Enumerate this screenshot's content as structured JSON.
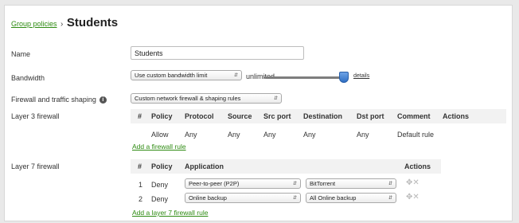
{
  "breadcrumb": {
    "parent": "Group policies",
    "separator": "›",
    "title": "Students"
  },
  "name": {
    "label": "Name",
    "value": "Students"
  },
  "bandwidth": {
    "label": "Bandwidth",
    "select_value": "Use custom bandwidth limit",
    "limit_text": "unlimited",
    "details_link": "details",
    "slider_level": "unlimited"
  },
  "firewall_shaping": {
    "label": "Firewall and traffic shaping",
    "select_value": "Custom network firewall & shaping rules"
  },
  "layer3": {
    "label": "Layer 3 firewall",
    "headers": [
      "#",
      "Policy",
      "Protocol",
      "Source",
      "Src port",
      "Destination",
      "Dst port",
      "Comment",
      "Actions"
    ],
    "rows": [
      {
        "num": "",
        "policy": "Allow",
        "protocol": "Any",
        "source": "Any",
        "src_port": "Any",
        "destination": "Any",
        "dst_port": "Any",
        "comment": "Default rule"
      }
    ],
    "add_link": "Add a firewall rule"
  },
  "layer7": {
    "label": "Layer 7 firewall",
    "headers": [
      "#",
      "Policy",
      "Application",
      "Actions"
    ],
    "rows": [
      {
        "num": "1",
        "policy": "Deny",
        "category": "Peer-to-peer (P2P)",
        "application": "BitTorrent"
      },
      {
        "num": "2",
        "policy": "Deny",
        "category": "Online backup",
        "application": "All Online backup"
      }
    ],
    "add_link": "Add a layer 7 firewall rule"
  }
}
